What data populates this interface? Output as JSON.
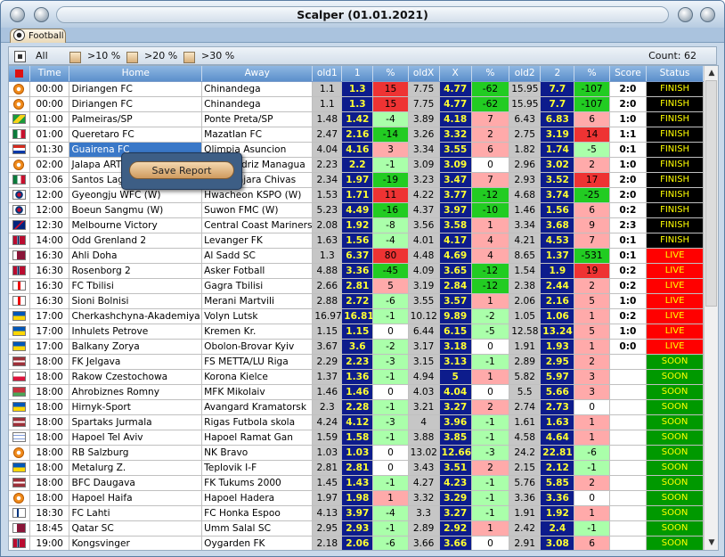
{
  "window": {
    "title": "Scalper (01.01.2021)"
  },
  "tab": {
    "label": "Football",
    "icon": "soccer-ball-icon"
  },
  "filters": [
    {
      "label": "All",
      "icon": "list-icon"
    },
    {
      "label": ">10 %"
    },
    {
      "label": ">20 %"
    },
    {
      "label": ">30 %"
    }
  ],
  "count_label": "Count: 62",
  "context_menu": {
    "save_report": "Save Report"
  },
  "columns": [
    "",
    "Time",
    "Home",
    "Away",
    "old1",
    "1",
    "%",
    "oldX",
    "X",
    "%",
    "old2",
    "2",
    "%",
    "Score",
    "Status"
  ],
  "colors": {
    "header": "#5b8fcb",
    "odd_bg": "#0d1c8c",
    "odd_text": "#ffff33",
    "old_bg": "#c6c6c6",
    "pos_strong": "#ee3333",
    "pos_light": "#ffaaaa",
    "neg_strong": "#22cc22",
    "neg_light": "#aaffaa",
    "finish_bg": "#000000",
    "finish_text": "#ffff00",
    "live_bg": "#ff0000",
    "soon_bg": "#009900"
  },
  "rows": [
    {
      "flag": "int",
      "time": "00:00",
      "home": "Diriangen FC",
      "away": "Chinandega",
      "old1": "1.1",
      "o1": "1.3",
      "p1": "15",
      "p1c": "red",
      "oldx": "7.75",
      "ox": "4.77",
      "px": "-62",
      "pxc": "green",
      "old2": "15.95",
      "o2": "7.7",
      "p2": "-107",
      "p2c": "green",
      "score": "2:0",
      "status": "FINISH"
    },
    {
      "flag": "int",
      "time": "00:00",
      "home": "Diriangen FC",
      "away": "Chinandega",
      "old1": "1.1",
      "o1": "1.3",
      "p1": "15",
      "p1c": "red",
      "oldx": "7.75",
      "ox": "4.77",
      "px": "-62",
      "pxc": "green",
      "old2": "15.95",
      "o2": "7.7",
      "p2": "-107",
      "p2c": "green",
      "score": "2:0",
      "status": "FINISH"
    },
    {
      "flag": "br",
      "time": "01:00",
      "home": "Palmeiras/SP",
      "away": "Ponte Preta/SP",
      "old1": "1.48",
      "o1": "1.42",
      "p1": "-4",
      "p1c": "lgreen",
      "oldx": "3.89",
      "ox": "4.18",
      "px": "7",
      "pxc": "lred",
      "old2": "6.43",
      "o2": "6.83",
      "p2": "6",
      "p2c": "lred",
      "score": "1:0",
      "status": "FINISH"
    },
    {
      "flag": "mx",
      "time": "01:00",
      "home": "Queretaro FC",
      "away": "Mazatlan FC",
      "old1": "2.47",
      "o1": "2.16",
      "p1": "-14",
      "p1c": "green",
      "oldx": "3.26",
      "ox": "3.32",
      "px": "2",
      "pxc": "lred",
      "old2": "2.75",
      "o2": "3.19",
      "p2": "14",
      "p2c": "red",
      "score": "1:1",
      "status": "FINISH"
    },
    {
      "flag": "py",
      "time": "01:30",
      "home": "Guairena FC",
      "away": "Olimpia Asuncion",
      "old1": "4.04",
      "o1": "4.16",
      "p1": "3",
      "p1c": "lred",
      "oldx": "3.34",
      "ox": "3.55",
      "px": "6",
      "pxc": "lred",
      "old2": "1.82",
      "o2": "1.74",
      "p2": "-5",
      "p2c": "lgreen",
      "score": "0:1",
      "status": "FINISH"
    },
    {
      "flag": "int",
      "time": "02:00",
      "home": "Jalapa ART",
      "away": "Real Madriz Managua",
      "old1": "2.23",
      "o1": "2.2",
      "p1": "-1",
      "p1c": "lgreen",
      "oldx": "3.09",
      "ox": "3.09",
      "px": "0",
      "pxc": "white",
      "old2": "2.96",
      "o2": "3.02",
      "p2": "2",
      "p2c": "lred",
      "score": "1:0",
      "status": "FINISH"
    },
    {
      "flag": "mx",
      "time": "03:06",
      "home": "Santos Laguna",
      "away": "Guadalajara Chivas",
      "old1": "2.34",
      "o1": "1.97",
      "p1": "-19",
      "p1c": "green",
      "oldx": "3.23",
      "ox": "3.47",
      "px": "7",
      "pxc": "lred",
      "old2": "2.93",
      "o2": "3.52",
      "p2": "17",
      "p2c": "red",
      "score": "2:0",
      "status": "FINISH"
    },
    {
      "flag": "kr",
      "time": "12:00",
      "home": "Gyeongju WFC (W)",
      "away": "Hwacheon KSPO (W)",
      "old1": "1.53",
      "o1": "1.71",
      "p1": "11",
      "p1c": "red",
      "oldx": "4.22",
      "ox": "3.77",
      "px": "-12",
      "pxc": "green",
      "old2": "4.68",
      "o2": "3.74",
      "p2": "-25",
      "p2c": "green",
      "score": "2:0",
      "status": "FINISH"
    },
    {
      "flag": "kr",
      "time": "12:00",
      "home": "Boeun Sangmu (W)",
      "away": "Suwon FMC (W)",
      "old1": "5.23",
      "o1": "4.49",
      "p1": "-16",
      "p1c": "green",
      "oldx": "4.37",
      "ox": "3.97",
      "px": "-10",
      "pxc": "green",
      "old2": "1.46",
      "o2": "1.56",
      "p2": "6",
      "p2c": "lred",
      "score": "0:2",
      "status": "FINISH"
    },
    {
      "flag": "au",
      "time": "12:30",
      "home": "Melbourne Victory",
      "away": "Central Coast Mariners",
      "old1": "2.08",
      "o1": "1.92",
      "p1": "-8",
      "p1c": "lgreen",
      "oldx": "3.56",
      "ox": "3.58",
      "px": "1",
      "pxc": "lred",
      "old2": "3.34",
      "o2": "3.68",
      "p2": "9",
      "p2c": "lred",
      "score": "2:3",
      "status": "FINISH"
    },
    {
      "flag": "no",
      "time": "14:00",
      "home": "Odd Grenland 2",
      "away": "Levanger FK",
      "old1": "1.63",
      "o1": "1.56",
      "p1": "-4",
      "p1c": "lgreen",
      "oldx": "4.01",
      "ox": "4.17",
      "px": "4",
      "pxc": "lred",
      "old2": "4.21",
      "o2": "4.53",
      "p2": "7",
      "p2c": "lred",
      "score": "0:1",
      "status": "FINISH"
    },
    {
      "flag": "qa",
      "time": "16:30",
      "home": "Ahli Doha",
      "away": "Al Sadd SC",
      "old1": "1.3",
      "o1": "6.37",
      "p1": "80",
      "p1c": "red",
      "oldx": "4.48",
      "ox": "4.69",
      "px": "4",
      "pxc": "lred",
      "old2": "8.65",
      "o2": "1.37",
      "p2": "-531",
      "p2c": "green",
      "score": "0:1",
      "status": "LIVE"
    },
    {
      "flag": "no",
      "time": "16:30",
      "home": "Rosenborg 2",
      "away": "Asker Fotball",
      "old1": "4.88",
      "o1": "3.36",
      "p1": "-45",
      "p1c": "green",
      "oldx": "4.09",
      "ox": "3.65",
      "px": "-12",
      "pxc": "green",
      "old2": "1.54",
      "o2": "1.9",
      "p2": "19",
      "p2c": "red",
      "score": "0:2",
      "status": "LIVE"
    },
    {
      "flag": "ge",
      "time": "16:30",
      "home": "FC Tbilisi",
      "away": "Gagra Tbilisi",
      "old1": "2.66",
      "o1": "2.81",
      "p1": "5",
      "p1c": "lred",
      "oldx": "3.19",
      "ox": "2.84",
      "px": "-12",
      "pxc": "green",
      "old2": "2.38",
      "o2": "2.44",
      "p2": "2",
      "p2c": "lred",
      "score": "0:2",
      "status": "LIVE"
    },
    {
      "flag": "ge",
      "time": "16:30",
      "home": "Sioni Bolnisi",
      "away": "Merani Martvili",
      "old1": "2.88",
      "o1": "2.72",
      "p1": "-6",
      "p1c": "lgreen",
      "oldx": "3.55",
      "ox": "3.57",
      "px": "1",
      "pxc": "lred",
      "old2": "2.06",
      "o2": "2.16",
      "p2": "5",
      "p2c": "lred",
      "score": "1:0",
      "status": "LIVE"
    },
    {
      "flag": "ua",
      "time": "17:00",
      "home": "Cherkashchyna-Akademiya",
      "away": "Volyn Lutsk",
      "old1": "16.97",
      "o1": "16.81",
      "p1": "-1",
      "p1c": "lgreen",
      "oldx": "10.12",
      "ox": "9.89",
      "px": "-2",
      "pxc": "lgreen",
      "old2": "1.05",
      "o2": "1.06",
      "p2": "1",
      "p2c": "lred",
      "score": "0:2",
      "status": "LIVE"
    },
    {
      "flag": "ua",
      "time": "17:00",
      "home": "Inhulets Petrove",
      "away": "Kremen Kr.",
      "old1": "1.15",
      "o1": "1.15",
      "p1": "0",
      "p1c": "white",
      "oldx": "6.44",
      "ox": "6.15",
      "px": "-5",
      "pxc": "lgreen",
      "old2": "12.58",
      "o2": "13.24",
      "p2": "5",
      "p2c": "lred",
      "score": "1:0",
      "status": "LIVE"
    },
    {
      "flag": "ua",
      "time": "17:00",
      "home": "Balkany Zorya",
      "away": "Obolon-Brovar Kyiv",
      "old1": "3.67",
      "o1": "3.6",
      "p1": "-2",
      "p1c": "lgreen",
      "oldx": "3.17",
      "ox": "3.18",
      "px": "0",
      "pxc": "white",
      "old2": "1.91",
      "o2": "1.93",
      "p2": "1",
      "p2c": "lred",
      "score": "0:0",
      "status": "LIVE"
    },
    {
      "flag": "lv",
      "time": "18:00",
      "home": "FK Jelgava",
      "away": "FS METTA/LU Riga",
      "old1": "2.29",
      "o1": "2.23",
      "p1": "-3",
      "p1c": "lgreen",
      "oldx": "3.15",
      "ox": "3.13",
      "px": "-1",
      "pxc": "lgreen",
      "old2": "2.89",
      "o2": "2.95",
      "p2": "2",
      "p2c": "lred",
      "score": "",
      "status": "SOON"
    },
    {
      "flag": "pl",
      "time": "18:00",
      "home": "Rakow Czestochowa",
      "away": "Korona Kielce",
      "old1": "1.37",
      "o1": "1.36",
      "p1": "-1",
      "p1c": "lgreen",
      "oldx": "4.94",
      "ox": "5",
      "px": "1",
      "pxc": "lred",
      "old2": "5.82",
      "o2": "5.97",
      "p2": "3",
      "p2c": "lred",
      "score": "",
      "status": "SOON"
    },
    {
      "flag": "by",
      "time": "18:00",
      "home": "Ahrobiznes Romny",
      "away": "MFK Mikolaiv",
      "old1": "1.46",
      "o1": "1.46",
      "p1": "0",
      "p1c": "white",
      "oldx": "4.03",
      "ox": "4.04",
      "px": "0",
      "pxc": "white",
      "old2": "5.5",
      "o2": "5.66",
      "p2": "3",
      "p2c": "lred",
      "score": "",
      "status": "SOON"
    },
    {
      "flag": "ua",
      "time": "18:00",
      "home": "Hirnyk-Sport",
      "away": "Avangard Kramatorsk",
      "old1": "2.3",
      "o1": "2.28",
      "p1": "-1",
      "p1c": "lgreen",
      "oldx": "3.21",
      "ox": "3.27",
      "px": "2",
      "pxc": "lred",
      "old2": "2.74",
      "o2": "2.73",
      "p2": "0",
      "p2c": "white",
      "score": "",
      "status": "SOON"
    },
    {
      "flag": "lv",
      "time": "18:00",
      "home": "Spartaks Jurmala",
      "away": "Rigas Futbola skola",
      "old1": "4.24",
      "o1": "4.12",
      "p1": "-3",
      "p1c": "lgreen",
      "oldx": "4",
      "ox": "3.96",
      "px": "-1",
      "pxc": "lgreen",
      "old2": "1.61",
      "o2": "1.63",
      "p2": "1",
      "p2c": "lred",
      "score": "",
      "status": "SOON"
    },
    {
      "flag": "il",
      "time": "18:00",
      "home": "Hapoel Tel Aviv",
      "away": "Hapoel Ramat Gan",
      "old1": "1.59",
      "o1": "1.58",
      "p1": "-1",
      "p1c": "lgreen",
      "oldx": "3.88",
      "ox": "3.85",
      "px": "-1",
      "pxc": "lgreen",
      "old2": "4.58",
      "o2": "4.64",
      "p2": "1",
      "p2c": "lred",
      "score": "",
      "status": "SOON"
    },
    {
      "flag": "int",
      "time": "18:00",
      "home": "RB Salzburg",
      "away": "NK Bravo",
      "old1": "1.03",
      "o1": "1.03",
      "p1": "0",
      "p1c": "white",
      "oldx": "13.02",
      "ox": "12.66",
      "px": "-3",
      "pxc": "lgreen",
      "old2": "24.2",
      "o2": "22.81",
      "p2": "-6",
      "p2c": "lgreen",
      "score": "",
      "status": "SOON"
    },
    {
      "flag": "ua",
      "time": "18:00",
      "home": "Metalurg Z.",
      "away": "Teplovik I-F",
      "old1": "2.81",
      "o1": "2.81",
      "p1": "0",
      "p1c": "white",
      "oldx": "3.43",
      "ox": "3.51",
      "px": "2",
      "pxc": "lred",
      "old2": "2.15",
      "o2": "2.12",
      "p2": "-1",
      "p2c": "lgreen",
      "score": "",
      "status": "SOON"
    },
    {
      "flag": "lv",
      "time": "18:00",
      "home": "BFC Daugava",
      "away": "FK Tukums 2000",
      "old1": "1.45",
      "o1": "1.43",
      "p1": "-1",
      "p1c": "lgreen",
      "oldx": "4.27",
      "ox": "4.23",
      "px": "-1",
      "pxc": "lgreen",
      "old2": "5.76",
      "o2": "5.85",
      "p2": "2",
      "p2c": "lred",
      "score": "",
      "status": "SOON"
    },
    {
      "flag": "int",
      "time": "18:00",
      "home": "Hapoel Haifa",
      "away": "Hapoel Hadera",
      "old1": "1.97",
      "o1": "1.98",
      "p1": "1",
      "p1c": "lred",
      "oldx": "3.32",
      "ox": "3.29",
      "px": "-1",
      "pxc": "lgreen",
      "old2": "3.36",
      "o2": "3.36",
      "p2": "0",
      "p2c": "white",
      "score": "",
      "status": "SOON"
    },
    {
      "flag": "fi",
      "time": "18:30",
      "home": "FC Lahti",
      "away": "FC Honka Espoo",
      "old1": "4.13",
      "o1": "3.97",
      "p1": "-4",
      "p1c": "lgreen",
      "oldx": "3.3",
      "ox": "3.27",
      "px": "-1",
      "pxc": "lgreen",
      "old2": "1.91",
      "o2": "1.92",
      "p2": "1",
      "p2c": "lred",
      "score": "",
      "status": "SOON"
    },
    {
      "flag": "qa",
      "time": "18:45",
      "home": "Qatar SC",
      "away": "Umm Salal SC",
      "old1": "2.95",
      "o1": "2.93",
      "p1": "-1",
      "p1c": "lgreen",
      "oldx": "2.89",
      "ox": "2.92",
      "px": "1",
      "pxc": "lred",
      "old2": "2.42",
      "o2": "2.4",
      "p2": "-1",
      "p2c": "lgreen",
      "score": "",
      "status": "SOON"
    },
    {
      "flag": "no",
      "time": "19:00",
      "home": "Kongsvinger",
      "away": "Oygarden FK",
      "old1": "2.18",
      "o1": "2.06",
      "p1": "-6",
      "p1c": "lgreen",
      "oldx": "3.66",
      "ox": "3.66",
      "px": "0",
      "pxc": "white",
      "old2": "2.91",
      "o2": "3.08",
      "p2": "6",
      "p2c": "lred",
      "score": "",
      "status": "SOON"
    }
  ]
}
